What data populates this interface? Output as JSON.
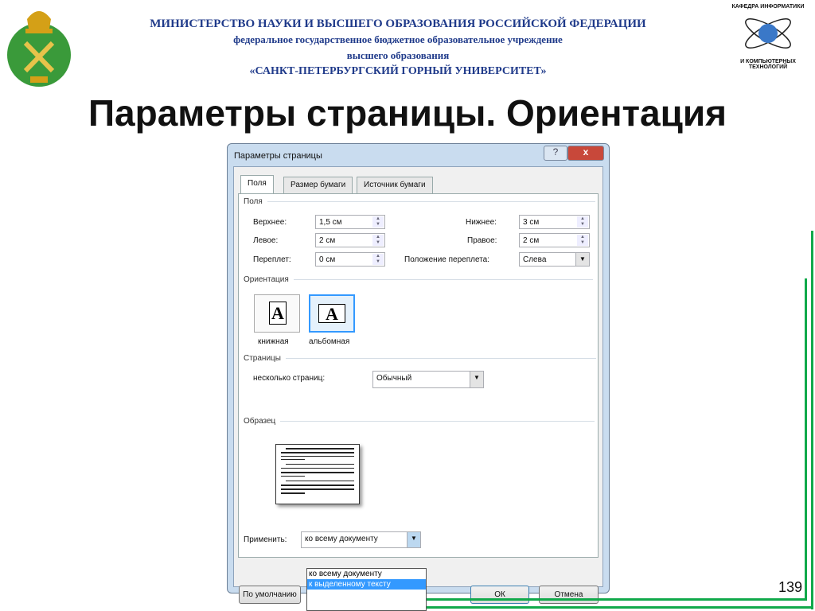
{
  "header": {
    "line1": "МИНИСТЕРСТВО НАУКИ И ВЫСШЕГО ОБРАЗОВАНИЯ РОССИЙСКОЙ ФЕДЕРАЦИИ",
    "line2": "федеральное государственное бюджетное образовательное учреждение",
    "line3": "высшего образования",
    "line4": "«САНКТ-ПЕТЕРБУРГСКИЙ ГОРНЫЙ УНИВЕРСИТЕТ»"
  },
  "logo_right": {
    "top": "КАФЕДРА ИНФОРМАТИКИ",
    "bottom": "И КОМПЬЮТЕРНЫХ ТЕХНОЛОГИЙ"
  },
  "slide_title": "Параметры страницы. Ориентация",
  "page_number": "139",
  "dialog": {
    "title": "Параметры страницы",
    "help": "?",
    "close": "x",
    "tabs": [
      "Поля",
      "Размер бумаги",
      "Источник бумаги"
    ],
    "margins_group": "Поля",
    "top_label": "Верхнее:",
    "top_value": "1,5 см",
    "bottom_label": "Нижнее:",
    "bottom_value": "3 см",
    "left_label": "Левое:",
    "left_value": "2 см",
    "right_label": "Правое:",
    "right_value": "2 см",
    "gutter_label": "Переплет:",
    "gutter_value": "0 см",
    "gutter_pos_label": "Положение переплета:",
    "gutter_pos_value": "Слева",
    "orientation_group": "Ориентация",
    "portrait": "книжная",
    "landscape": "альбомная",
    "glyph": "A",
    "pages_group": "Страницы",
    "multiple_label": "несколько страниц:",
    "multiple_value": "Обычный",
    "preview_group": "Образец",
    "apply_label": "Применить:",
    "apply_value": "ко всему документу",
    "apply_options": [
      "ко всему документу",
      "к выделенному тексту"
    ],
    "default_btn": "По умолчанию",
    "ok": "ОК",
    "cancel": "Отмена"
  }
}
